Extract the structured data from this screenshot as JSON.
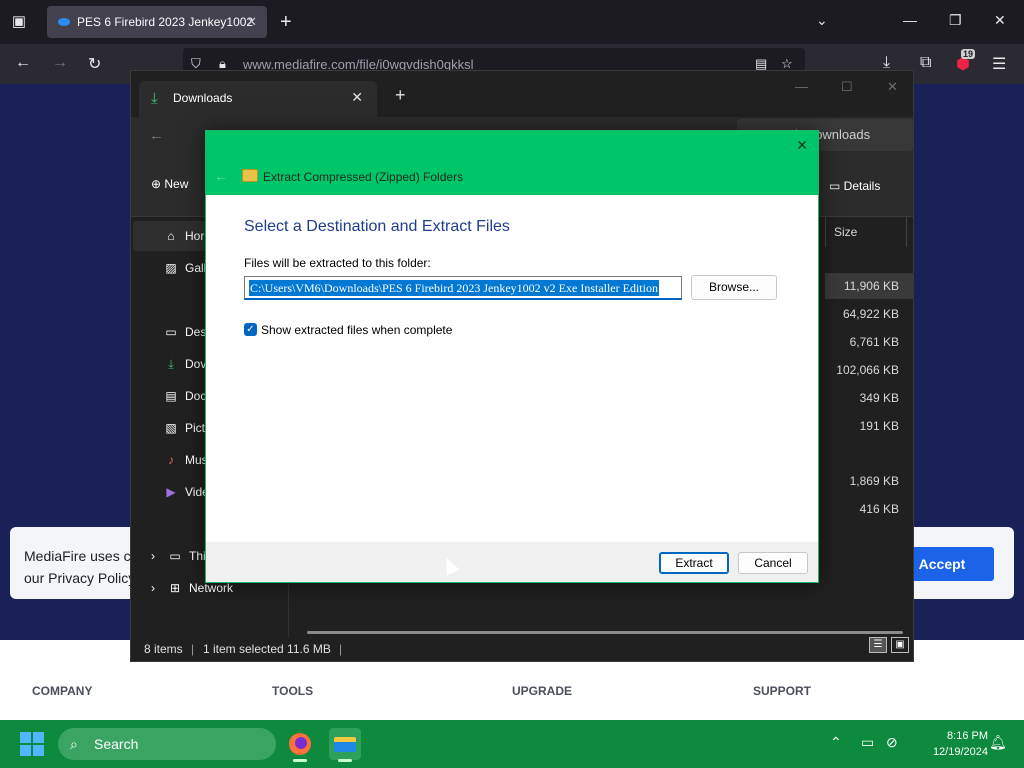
{
  "browser": {
    "tab_title": "PES 6 Firebird 2023 Jenkey1002",
    "url": "www.mediafire.com/file/i0wgvdish0qkksl",
    "extensions_badge": "19"
  },
  "webpage": {
    "cookie_text": "MediaFire uses co our Privacy Policy",
    "accept_label": "Accept",
    "footer_cols": [
      "COMPANY",
      "TOOLS",
      "UPGRADE",
      "SUPPORT"
    ]
  },
  "explorer": {
    "tab_title": "Downloads",
    "search_placeholder": "Search Downloads",
    "new_label": "New",
    "details_label": "Details",
    "sidebar": [
      {
        "label": "Hor",
        "icon": "home-icon"
      },
      {
        "label": "Gall",
        "icon": "gallery-icon"
      },
      {
        "label": "Des",
        "icon": "desktop-icon"
      },
      {
        "label": "Dov",
        "icon": "downloads-icon"
      },
      {
        "label": "Doc",
        "icon": "documents-icon"
      },
      {
        "label": "Pict",
        "icon": "pictures-icon"
      },
      {
        "label": "Mus",
        "icon": "music-icon"
      },
      {
        "label": "Vide",
        "icon": "videos-icon"
      },
      {
        "label": "This",
        "icon": "this-pc-icon"
      },
      {
        "label": "Network",
        "icon": "network-icon"
      }
    ],
    "size_header": "Size",
    "sizes": [
      "11,906 KB",
      "64,922 KB",
      "6,761 KB",
      "102,066 KB",
      "349 KB",
      "191 KB",
      "1,869 KB",
      "416 KB"
    ],
    "status_items": "8 items",
    "status_selected": "1 item selected  11.6 MB"
  },
  "dialog": {
    "title": "Extract Compressed (Zipped) Folders",
    "heading": "Select a Destination and Extract Files",
    "path_label": "Files will be extracted to this folder:",
    "path_value": "C:\\Users\\VM6\\Downloads\\PES 6 Firebird 2023 Jenkey1002 v2 Exe Installer Edition",
    "browse_label": "Browse...",
    "checkbox_label": "Show extracted files when complete",
    "checkbox_checked": true,
    "extract_label": "Extract",
    "cancel_label": "Cancel"
  },
  "taskbar": {
    "search_label": "Search",
    "time": "8:16 PM",
    "date": "12/19/2024"
  },
  "colors": {
    "dialog_header": "#00c569",
    "taskbar": "#0d8a3d",
    "accent": "#0078d4"
  }
}
